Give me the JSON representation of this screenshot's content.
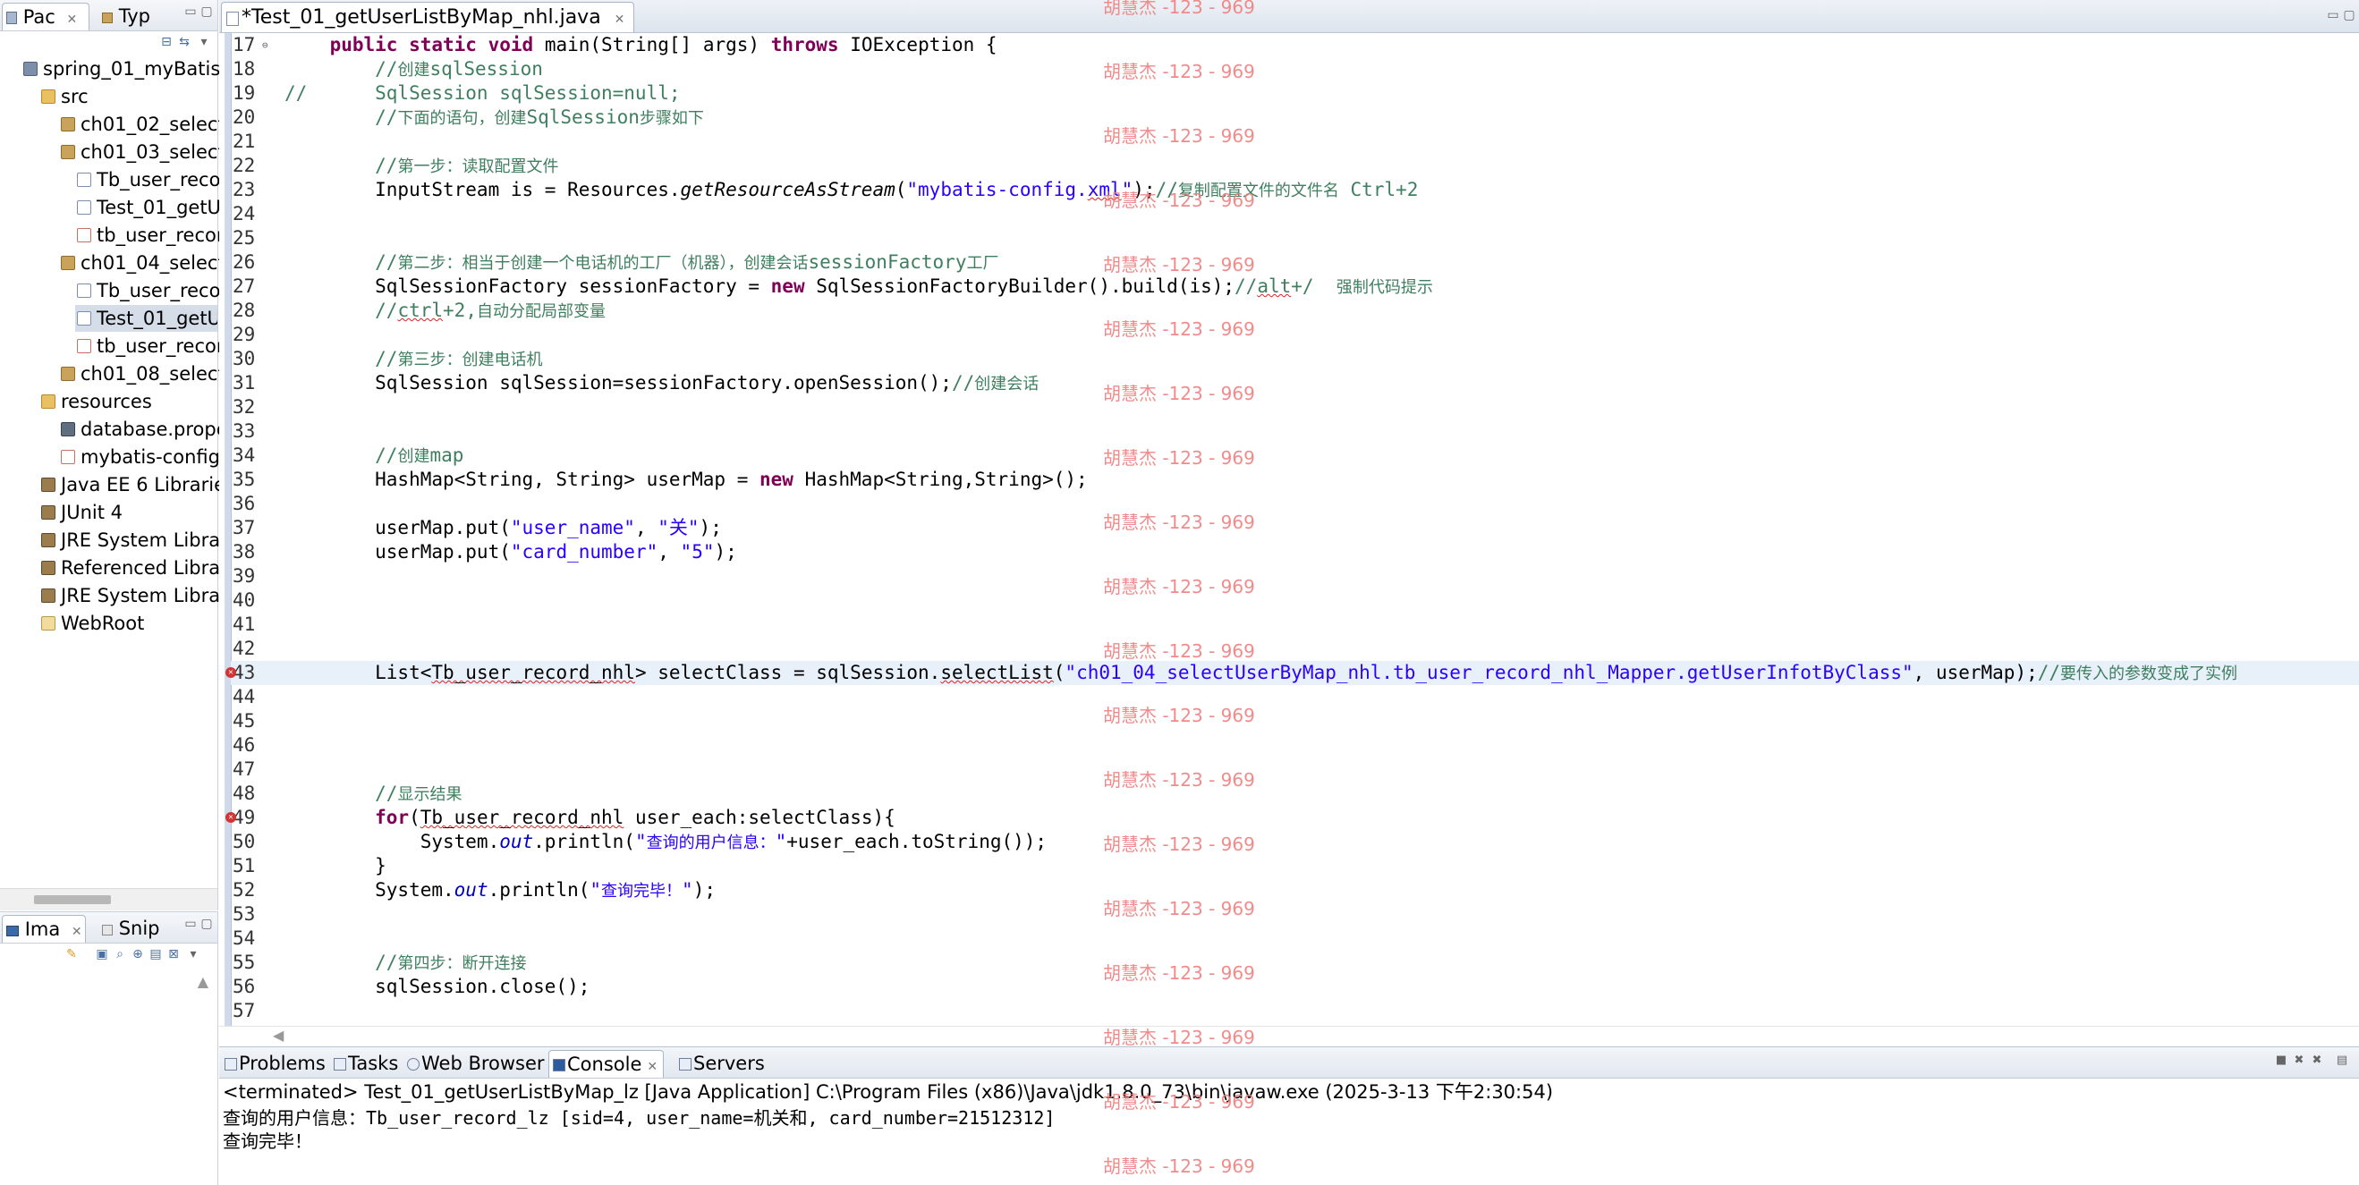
{
  "left_top": {
    "tabs": [
      {
        "label": "Pac",
        "close": "✕"
      },
      {
        "label": "Typ"
      }
    ],
    "tree": [
      {
        "label": "spring_01_myBatis",
        "icon": "project-icon"
      },
      {
        "label": "src",
        "icon": "folder-icon"
      },
      {
        "label": "ch01_02_select",
        "icon": "package-icon"
      },
      {
        "label": "ch01_03_select",
        "icon": "package-icon"
      },
      {
        "label": "Tb_user_reco",
        "icon": "java-file-icon"
      },
      {
        "label": "Test_01_getU",
        "icon": "java-file-icon"
      },
      {
        "label": "tb_user_recor",
        "icon": "xml-file-icon"
      },
      {
        "label": "ch01_04_select",
        "icon": "package-icon"
      },
      {
        "label": "Tb_user_reco",
        "icon": "java-file-icon"
      },
      {
        "label": "Test_01_getU",
        "icon": "java-file-icon"
      },
      {
        "label": "tb_user_recor",
        "icon": "xml-file-icon"
      },
      {
        "label": "ch01_08_select",
        "icon": "package-icon"
      },
      {
        "label": "resources",
        "icon": "folder-icon"
      },
      {
        "label": "database.prope",
        "icon": "properties-file-icon"
      },
      {
        "label": "mybatis-config",
        "icon": "xml-file-icon"
      },
      {
        "label": "Java EE 6 Librarie",
        "icon": "library-icon"
      },
      {
        "label": "JUnit 4",
        "icon": "library-icon"
      },
      {
        "label": "JRE System Libra",
        "icon": "library-icon"
      },
      {
        "label": "Referenced Libra",
        "icon": "library-icon"
      },
      {
        "label": "JRE System Libra",
        "icon": "library-icon"
      },
      {
        "label": "WebRoot",
        "icon": "webroot-folder-icon"
      }
    ]
  },
  "left_bottom": {
    "tabs": [
      {
        "label": "Ima",
        "close": "✕"
      },
      {
        "label": "Snip"
      }
    ]
  },
  "editor": {
    "tab_label": "*Test_01_getUserListByMap_nhl.java",
    "tab_close": "✕",
    "lines": [
      {
        "n": "17",
        "html": "    <span class=\"kw\">public</span> <span class=\"kw\">static</span> <span class=\"kw\">void</span> main(String[] args) <span class=\"kw\">throws</span> IOException {"
      },
      {
        "n": "18",
        "html": "        <span class=\"cm\">//</span><span class=\"cm-cn\">创建</span><span class=\"cm\">sqlSession</span>"
      },
      {
        "n": "19",
        "html": "<span class=\"cm\">//      SqlSession sqlSession=null;</span>"
      },
      {
        "n": "20",
        "html": "        <span class=\"cm\">//</span><span class=\"cm-cn\">下面的语句，创建</span><span class=\"cm\">SqlSession</span><span class=\"cm-cn\">步骤如下</span>"
      },
      {
        "n": "21",
        "html": ""
      },
      {
        "n": "22",
        "html": "        <span class=\"cm\">//</span><span class=\"cm-cn\">第一步：读取配置文件</span>"
      },
      {
        "n": "23",
        "html": "        InputStream is = Resources.<span class=\"it\">getResourceAsStream</span>(<span class=\"str\">\"mybatis-config.<span class=\"sq\">xml</span>\"</span>);<span class=\"cm\">//</span><span class=\"cm-cn\">复制配置文件的文件名</span> <span class=\"cm\">Ctrl+2</span>"
      },
      {
        "n": "24",
        "html": ""
      },
      {
        "n": "25",
        "html": ""
      },
      {
        "n": "26",
        "html": "        <span class=\"cm\">//</span><span class=\"cm-cn\">第二步：相当于创建一个电话机的工厂（机器），创建会话</span><span class=\"cm\">sessionFactory</span><span class=\"cm-cn\">工厂</span>"
      },
      {
        "n": "27",
        "html": "        SqlSessionFactory sessionFactory = <span class=\"kw\">new</span> SqlSessionFactoryBuilder().build(is);<span class=\"cm\">//<span class=\"sq\">alt</span>+/  </span><span class=\"cm-cn\">强制代码提示</span>"
      },
      {
        "n": "28",
        "html": "        <span class=\"cm\">//<span class=\"sq\">ctrl</span>+2,</span><span class=\"cm-cn\">自动分配局部变量</span>"
      },
      {
        "n": "29",
        "html": ""
      },
      {
        "n": "30",
        "html": "        <span class=\"cm\">//</span><span class=\"cm-cn\">第三步：创建电话机</span>"
      },
      {
        "n": "31",
        "html": "        SqlSession sqlSession=sessionFactory.openSession();<span class=\"cm\">//</span><span class=\"cm-cn\">创建会话</span>"
      },
      {
        "n": "32",
        "html": ""
      },
      {
        "n": "33",
        "html": ""
      },
      {
        "n": "34",
        "html": "        <span class=\"cm\">//</span><span class=\"cm-cn\">创建</span><span class=\"cm\">map</span>"
      },
      {
        "n": "35",
        "html": "        HashMap&lt;String, String&gt; userMap = <span class=\"kw\">new</span> HashMap&lt;String,String&gt;();"
      },
      {
        "n": "36",
        "html": ""
      },
      {
        "n": "37",
        "html": "        userMap.put(<span class=\"str\">\"user_name\"</span>, <span class=\"str\">\"关\"</span>);"
      },
      {
        "n": "38",
        "html": "        userMap.put(<span class=\"str\">\"card_number\"</span>, <span class=\"str\">\"5\"</span>);"
      },
      {
        "n": "39",
        "html": ""
      },
      {
        "n": "40",
        "html": ""
      },
      {
        "n": "41",
        "html": ""
      },
      {
        "n": "42",
        "html": ""
      },
      {
        "n": "43",
        "html": "        List&lt;<span class=\"sq\">Tb_user_record_nhl</span>&gt; selectClass = sqlSession.<span class=\"sq\">selectList</span>(<span class=\"str\">\"ch01_04_selectUserByMap_nhl.tb_user_record_nhl_Mapper.getUserInfotByClass\"</span>, userMap);<span class=\"cm\">//</span><span class=\"cm-cn\">要传入的参数变成了实例</span>",
        "current": true,
        "error": true
      },
      {
        "n": "44",
        "html": ""
      },
      {
        "n": "45",
        "html": ""
      },
      {
        "n": "46",
        "html": ""
      },
      {
        "n": "47",
        "html": ""
      },
      {
        "n": "48",
        "html": "        <span class=\"cm\">//</span><span class=\"cm-cn\">显示结果</span>"
      },
      {
        "n": "49",
        "html": "        <span class=\"kw\">for</span>(<span class=\"sq\">Tb_user_record_nhl</span> user_each:selectClass){",
        "error": true
      },
      {
        "n": "50",
        "html": "            System.<span class=\"fld\">out</span>.println(<span class=\"str\">\"</span><span class=\"cm-cn\" style=\"color:#2a00ff\">查询的用户信息：</span><span class=\"str\">\"</span>+user_each.toString());"
      },
      {
        "n": "51",
        "html": "        }"
      },
      {
        "n": "52",
        "html": "        System.<span class=\"fld\">out</span>.println(<span class=\"str\">\"</span><span class=\"cm-cn\" style=\"color:#2a00ff\">查询完毕！</span><span class=\"str\">\"</span>);"
      },
      {
        "n": "53",
        "html": ""
      },
      {
        "n": "54",
        "html": ""
      },
      {
        "n": "55",
        "html": "        <span class=\"cm\">//</span><span class=\"cm-cn\">第四步：断开连接</span>"
      },
      {
        "n": "56",
        "html": "        sqlSession.close();"
      },
      {
        "n": "57",
        "html": ""
      }
    ]
  },
  "console": {
    "tabs": [
      {
        "label": "Problems"
      },
      {
        "label": "Tasks"
      },
      {
        "label": "Web Browser"
      },
      {
        "label": "Console",
        "close": "✕"
      },
      {
        "label": "Servers"
      }
    ],
    "status": "<terminated> Test_01_getUserListByMap_lz [Java Application] C:\\Program Files (x86)\\Java\\jdk1.8.0_73\\bin\\javaw.exe (2025-3-13 下午2:30:54)",
    "output": [
      "查询的用户信息：Tb_user_record_lz [sid=4, user_name=机关和, card_number=21512312]",
      "查询完毕！"
    ]
  },
  "watermark": {
    "text": "胡慧杰 -123 - 969"
  }
}
